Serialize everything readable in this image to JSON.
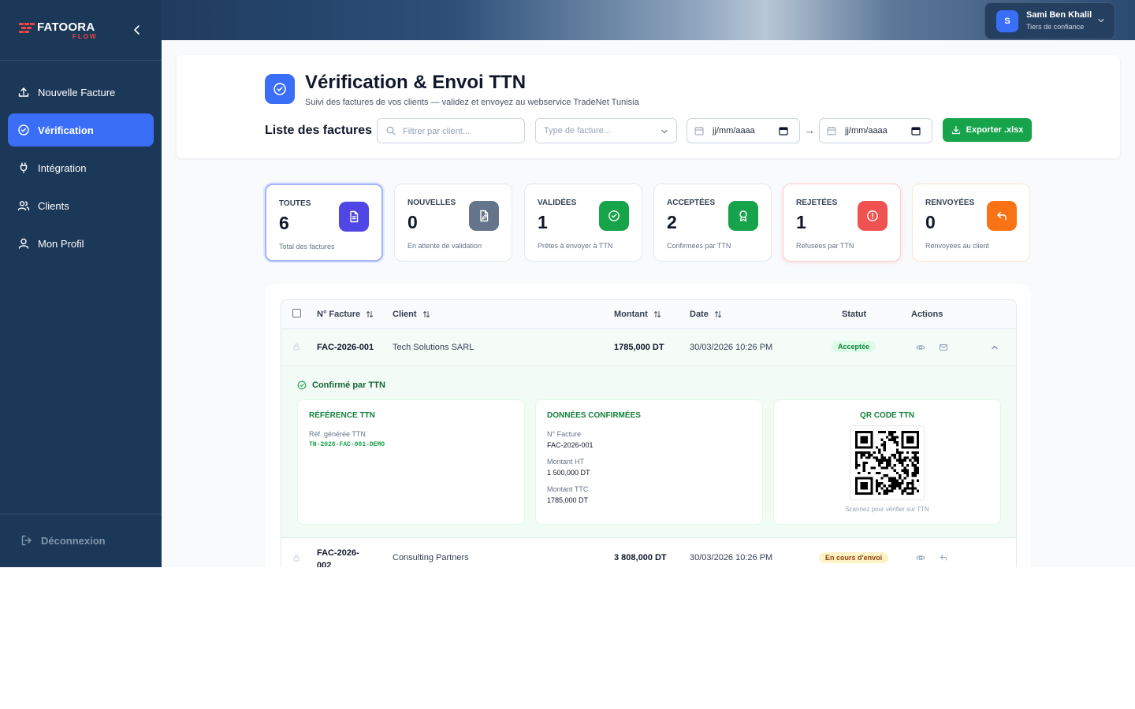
{
  "brand": {
    "name": "FATOORA",
    "sub": "FLOW",
    "accent": "#ef4444"
  },
  "nav": {
    "items": [
      {
        "label": "Nouvelle Facture",
        "icon": "upload-icon"
      },
      {
        "label": "Vérification",
        "icon": "check-circle-icon",
        "active": true
      },
      {
        "label": "Intégration",
        "icon": "plug-icon"
      },
      {
        "label": "Clients",
        "icon": "users-icon"
      },
      {
        "label": "Mon Profil",
        "icon": "user-icon"
      }
    ],
    "logout": "Déconnexion"
  },
  "user": {
    "initial": "S",
    "name": "Sami Ben Khalil",
    "role": "Tiers de confiance"
  },
  "header": {
    "title": "Vérification & Envoi TTN",
    "subtitle": "Suivi des factures de vos clients — validez et envoyez au webservice TradeNet Tunisia",
    "list_title": "Liste des factures",
    "search_placeholder": "Filtrer par client...",
    "type_placeholder": "Type de facture...",
    "date_from": "jj/mm/aaaa",
    "date_to": "jj/mm/aaaa",
    "arrow": "→",
    "export_label": "Exporter .xlsx"
  },
  "stats": [
    {
      "label": "TOUTES",
      "value": "6",
      "desc": "Total des factures",
      "color": "#4f46e5",
      "icon": "document-icon"
    },
    {
      "label": "NOUVELLES",
      "value": "0",
      "desc": "En attente de validation",
      "color": "#64748b",
      "icon": "file-edit-icon"
    },
    {
      "label": "VALIDÉES",
      "value": "1",
      "desc": "Prêtes à envoyer à TTN",
      "color": "#16a34a",
      "icon": "check-circle-icon"
    },
    {
      "label": "ACCEPTÉES",
      "value": "2",
      "desc": "Confirmées par TTN",
      "color": "#16a34a",
      "icon": "award-icon"
    },
    {
      "label": "REJETÉES",
      "value": "1",
      "desc": "Refusées par TTN",
      "color": "#ef4444",
      "icon": "alert-circle-icon"
    },
    {
      "label": "RENVOYÉES",
      "value": "0",
      "desc": "Renvoyées au client",
      "color": "#f97316",
      "icon": "reply-icon"
    }
  ],
  "table": {
    "headers": {
      "number": "N° Facture",
      "client": "Client",
      "amount": "Montant",
      "date": "Date",
      "status": "Statut",
      "actions": "Actions"
    },
    "rows": [
      {
        "number": "FAC-2026-001",
        "client": "Tech Solutions SARL",
        "amount": "1785,000 DT",
        "date": "30/03/2026 10:26 PM",
        "status": "Acceptée"
      },
      {
        "number": "FAC-2026-002",
        "client": "Consulting Partners",
        "amount": "3 808,000 DT",
        "date": "30/03/2026 10:26 PM",
        "status": "En cours d'envoi"
      }
    ]
  },
  "detail": {
    "confirmed": "Confirmé par TTN",
    "ref_title": "RÉFÉRENCE TTN",
    "ref_label": "Réf. générée TTN",
    "ref_value": "TN-2026-FAC-001-DEMO",
    "data_title": "DONNÉES CONFIRMÉES",
    "num_label": "N° Facture",
    "num_value": "FAC-2026-001",
    "ht_label": "Montant HT",
    "ht_value": "1 500,000 DT",
    "ttc_label": "Montant TTC",
    "ttc_value": "1785,000 DT",
    "qr_title": "QR CODE TTN",
    "qr_caption": "Scannez pour vérifier sur TTN"
  }
}
